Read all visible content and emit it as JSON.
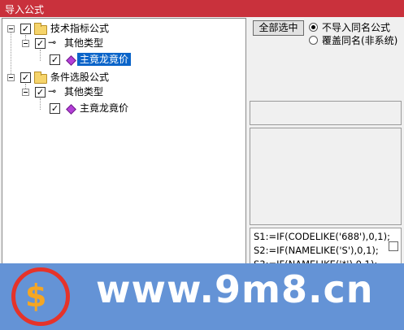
{
  "window": {
    "title": "导入公式"
  },
  "tree": {
    "groups": [
      {
        "label": "技术指标公式",
        "child": "其他类型",
        "leaf": "主竟龙竟价"
      },
      {
        "label": "条件选股公式",
        "child": "其他类型",
        "leaf": "主竟龙竟价"
      }
    ]
  },
  "controls": {
    "select_all": "全部选中",
    "options": [
      "不导入同名公式",
      "覆盖同名(非系统)"
    ]
  },
  "code": {
    "lines": [
      "S1:=IF(CODELIKE('688'),0,1);",
      "S2:=IF(NAMELIKE('S'),0,1);",
      "S3:=IF(NAMELIKE('*'),0,1);"
    ]
  },
  "watermark": {
    "url": "www.9m8.cn",
    "logo_text": "www.9m8.cn"
  },
  "colors": {
    "titlebar": "#c9313c",
    "selection": "#0a64c9",
    "banner": "#6493d6"
  }
}
